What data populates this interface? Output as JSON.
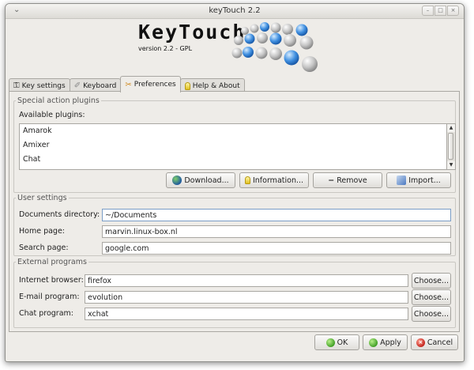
{
  "window": {
    "title": "keyTouch 2.2",
    "menu_glyph": "⌄",
    "controls": {
      "minimize": "–",
      "maximize": "□",
      "close": "×"
    }
  },
  "logo": {
    "wordmark": "KeyTouch",
    "version": "version 2.2 - GPL"
  },
  "tabs": [
    {
      "label": "Key settings",
      "icon": "key-icon",
      "active": false
    },
    {
      "label": "Keyboard",
      "icon": "pen-icon",
      "active": false
    },
    {
      "label": "Preferences",
      "icon": "tools-icon",
      "active": true
    },
    {
      "label": "Help & About",
      "icon": "bulb-icon",
      "active": false
    }
  ],
  "special_action_plugins": {
    "legend": "Special action plugins",
    "available_label": "Available plugins:",
    "plugins": [
      "Amarok",
      "Amixer",
      "Chat"
    ],
    "buttons": {
      "download": "Download...",
      "information": "Information...",
      "remove": "Remove",
      "import": "Import..."
    }
  },
  "user_settings": {
    "legend": "User settings",
    "fields": [
      {
        "label": "Documents directory:",
        "value": "~/Documents"
      },
      {
        "label": "Home page:",
        "value": "marvin.linux-box.nl"
      },
      {
        "label": "Search page:",
        "value": "google.com"
      }
    ]
  },
  "external_programs": {
    "legend": "External programs",
    "choose_label": "Choose...",
    "fields": [
      {
        "label": "Internet browser:",
        "value": "firefox"
      },
      {
        "label": "E-mail program:",
        "value": "evolution"
      },
      {
        "label": "Chat program:",
        "value": "xchat"
      }
    ]
  },
  "footer": {
    "ok": "OK",
    "apply": "Apply",
    "cancel": "Cancel"
  },
  "colors": {
    "window_bg": "#eeece8",
    "focus_border": "#7a9dc6",
    "logo_dot_blue": "#3f8fe0",
    "logo_dot_grey": "#b9b9b9"
  }
}
